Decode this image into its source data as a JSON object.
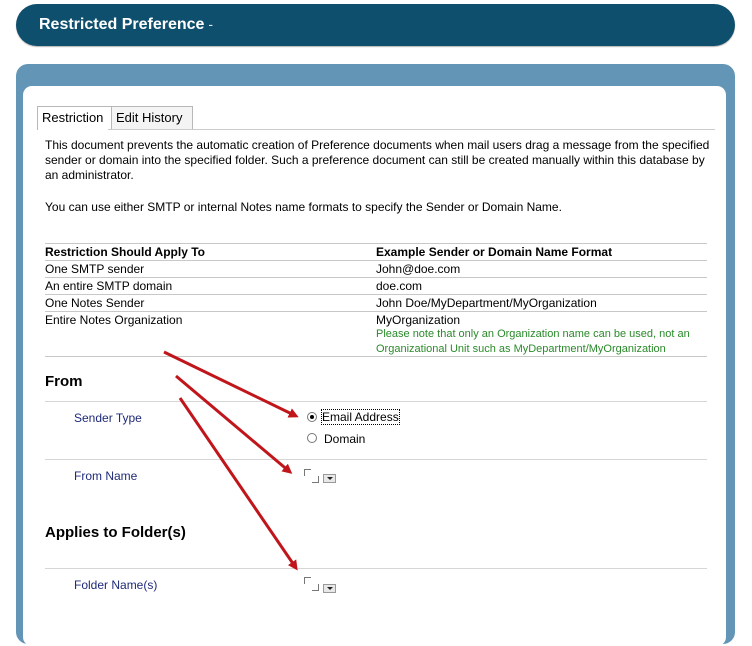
{
  "header": {
    "title": "Restricted Preference",
    "title_suffix": "-"
  },
  "tabs": [
    {
      "label": "Restriction",
      "active": true
    },
    {
      "label": "Edit History",
      "active": false
    }
  ],
  "intro": {
    "paragraph1": "This document prevents the automatic creation of Preference documents when mail users drag a message from the specified sender or domain into the specified folder.  Such a preference document can still be created manually within this database by an administrator.",
    "paragraph2": "You can use either SMTP or internal Notes name formats to specify the Sender or Domain Name."
  },
  "table": {
    "headers": [
      "Restriction Should Apply To",
      "Example Sender or Domain Name Format"
    ],
    "rows": [
      [
        "One SMTP sender",
        "John@doe.com"
      ],
      [
        "An entire SMTP domain",
        "doe.com"
      ],
      [
        "One Notes Sender",
        "John Doe/MyDepartment/MyOrganization"
      ],
      [
        "Entire Notes Organization",
        "MyOrganization"
      ]
    ],
    "note": "Please note that only an Organization name can be used, not an Organizational Unit such as MyDepartment/MyOrganization"
  },
  "from_section": {
    "title": "From",
    "sender_type_label": "Sender Type",
    "sender_type_options": [
      "Email Address",
      "Domain"
    ],
    "sender_type_selected": "Email Address",
    "from_name_label": "From Name"
  },
  "folder_section": {
    "title": "Applies to Folder(s)",
    "folder_name_label": "Folder Name(s)"
  },
  "colors": {
    "title_bar": "#0f4f6e",
    "frame": "#6396b6",
    "field_label": "#1f2a78",
    "note": "#2a8a2a",
    "arrow": "#c0161b"
  }
}
